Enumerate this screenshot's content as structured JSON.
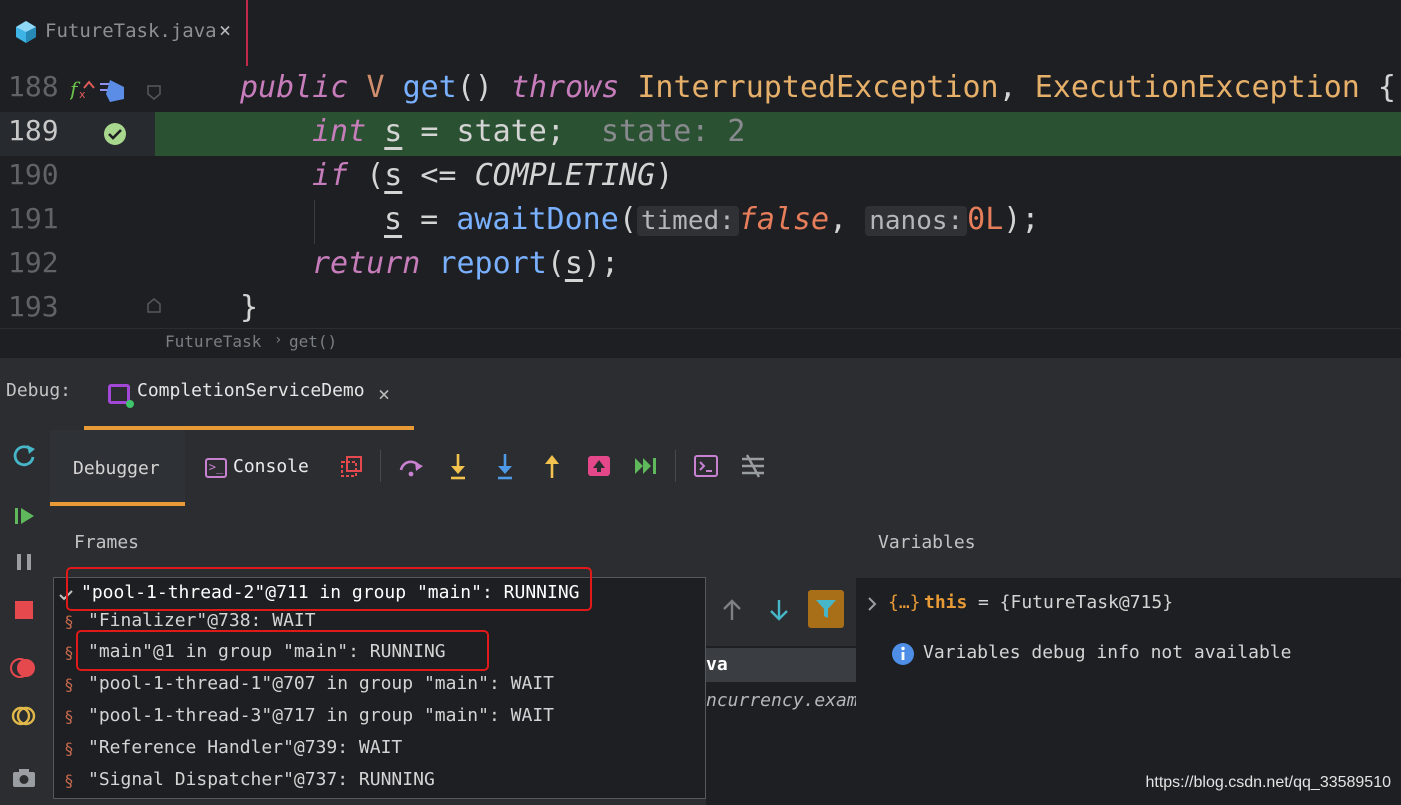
{
  "editor_tab": {
    "title": "FutureTask.java",
    "close": "×"
  },
  "editor": {
    "lines": [
      {
        "num": "188"
      },
      {
        "num": "189",
        "inline_value": "state: 2"
      },
      {
        "num": "190"
      },
      {
        "num": "191",
        "hint_timed": "timed:",
        "hint_nanos": "nanos:"
      },
      {
        "num": "192"
      },
      {
        "num": "193"
      }
    ],
    "breadcrumb": {
      "class": "FutureTask",
      "sep": "›",
      "method": "get()"
    }
  },
  "debug": {
    "label": "Debug:",
    "run_config": "CompletionServiceDemo",
    "close": "×",
    "tabs": {
      "debugger": "Debugger",
      "console": "Console"
    },
    "frames_title": "Frames",
    "variables_title": "Variables",
    "frame_snippets": {
      "file": "va",
      "package": "ncurrency.exam"
    },
    "threads": [
      {
        "label": "\"pool-1-thread-2\"@711 in group \"main\": RUNNING",
        "selected": true
      },
      {
        "label": "\"Finalizer\"@738: WAIT"
      },
      {
        "label": "\"main\"@1 in group \"main\": RUNNING"
      },
      {
        "label": "\"pool-1-thread-1\"@707 in group \"main\": WAIT"
      },
      {
        "label": "\"pool-1-thread-3\"@717 in group \"main\": WAIT"
      },
      {
        "label": "\"Reference Handler\"@739: WAIT"
      },
      {
        "label": "\"Signal Dispatcher\"@737: RUNNING"
      }
    ],
    "variables": {
      "this_name": "this",
      "this_value": "= {FutureTask@715}",
      "info": "Variables debug info not available"
    }
  },
  "watermark": "https://blog.csdn.net/qq_33589510",
  "colors": {
    "accent": "#e79a36",
    "execution_line": "#2b5133",
    "highlight_box": "#e01919"
  }
}
